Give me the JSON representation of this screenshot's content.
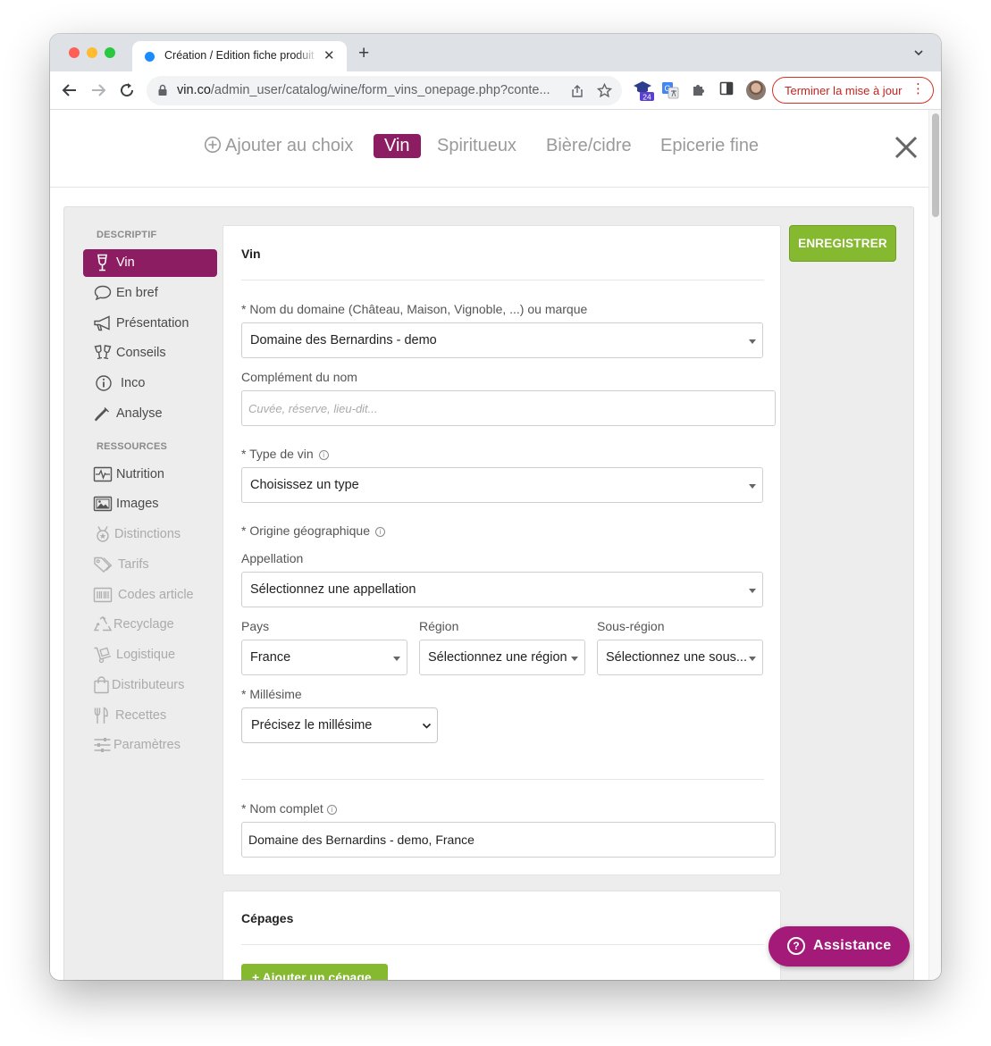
{
  "browser": {
    "tab_title": "Création / Edition fiche produit",
    "url_host": "vin.co",
    "url_path": "/admin_user/catalog/wine/form_vins_onepage.php?conte...",
    "update_button": "Terminer la mise à jour",
    "extension_badge": "24"
  },
  "topnav": {
    "add_choice": "Ajouter au choix",
    "items": [
      "Vin",
      "Spiritueux",
      "Bière/cidre",
      "Epicerie fine"
    ]
  },
  "sidebar": {
    "section_descriptif": "DESCRIPTIF",
    "section_ressources": "RESSOURCES",
    "items": [
      {
        "label": "Vin",
        "icon": "wine-glass-icon"
      },
      {
        "label": "En bref",
        "icon": "speech-bubble-icon"
      },
      {
        "label": "Présentation",
        "icon": "megaphone-icon"
      },
      {
        "label": "Conseils",
        "icon": "cheers-icon"
      },
      {
        "label": "Inco",
        "icon": "info-circle-icon"
      },
      {
        "label": "Analyse",
        "icon": "pipette-icon"
      },
      {
        "label": "Nutrition",
        "icon": "pulse-icon"
      },
      {
        "label": "Images",
        "icon": "images-icon"
      },
      {
        "label": "Distinctions",
        "icon": "medal-icon"
      },
      {
        "label": "Tarifs",
        "icon": "tags-icon"
      },
      {
        "label": "Codes article",
        "icon": "barcode-icon"
      },
      {
        "label": "Recyclage",
        "icon": "recycle-icon"
      },
      {
        "label": "Logistique",
        "icon": "dolly-icon"
      },
      {
        "label": "Distributeurs",
        "icon": "shopping-bag-icon"
      },
      {
        "label": "Recettes",
        "icon": "utensils-icon"
      },
      {
        "label": "Paramètres",
        "icon": "sliders-icon"
      }
    ]
  },
  "form": {
    "card_title": "Vin",
    "domain_label": "* Nom du domaine (Château, Maison, Vignoble, ...) ou marque",
    "domain_value": "Domaine des Bernardins - demo",
    "complement_label": "Complément du nom",
    "complement_placeholder": "Cuvée, réserve, lieu-dit...",
    "type_label": "* Type de vin",
    "type_value": "Choisissez un type",
    "origin_label": "* Origine géographique",
    "appellation_label": "Appellation",
    "appellation_value": "Sélectionnez une appellation",
    "pays_label": "Pays",
    "pays_value": "France",
    "region_label": "Région",
    "region_value": "Sélectionnez une région",
    "sous_region_label": "Sous-région",
    "sous_region_value": "Sélectionnez une sous...",
    "millesime_label": "* Millésime",
    "millesime_value": "Précisez le millésime",
    "full_name_label": "* Nom complet",
    "full_name_value": "Domaine des Bernardins - demo, France"
  },
  "cepages": {
    "card_title": "Cépages",
    "add_button": "+ Ajouter un cépage"
  },
  "save_button": "ENREGISTRER",
  "assistance_button": "Assistance",
  "colors": {
    "brand": "#8d1d63",
    "save_green": "#85b930",
    "assistance": "#a31a78"
  }
}
